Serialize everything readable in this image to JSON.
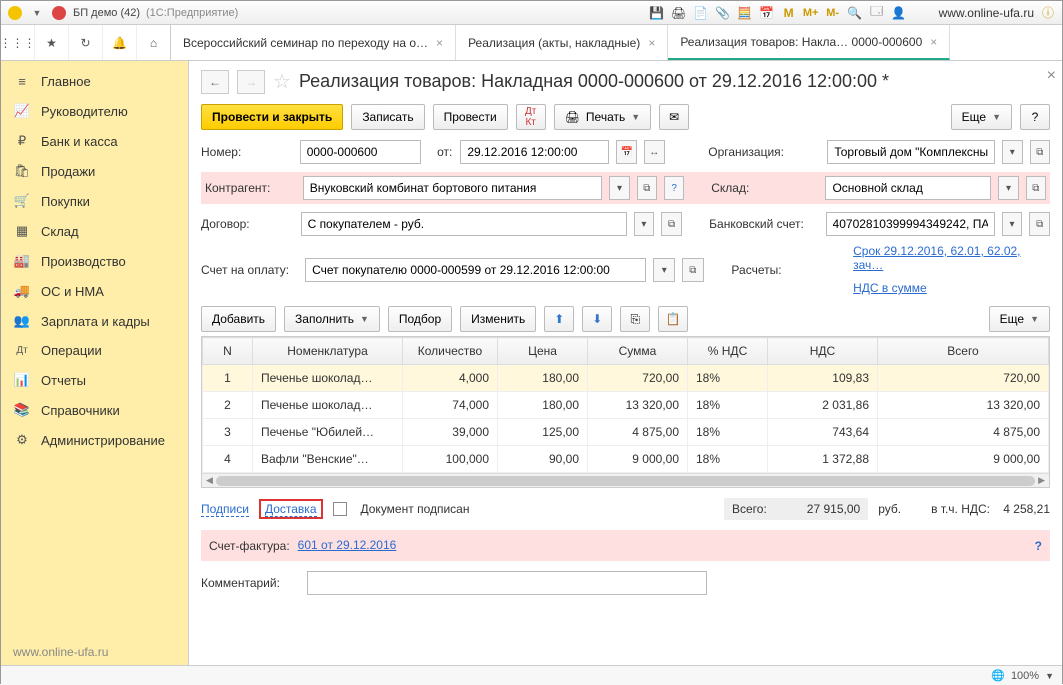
{
  "titlebar": {
    "app_name": "БП демо (42)",
    "platform": "(1С:Предприятие)",
    "url": "www.online-ufa.ru"
  },
  "tabs": [
    {
      "label": "Всероссийский семинар по переходу на о…",
      "active": false
    },
    {
      "label": "Реализация (акты, накладные)",
      "active": false
    },
    {
      "label": "Реализация товаров: Накла…   0000-000600",
      "active": true
    }
  ],
  "sidebar": {
    "items": [
      {
        "icon": "≡",
        "label": "Главное"
      },
      {
        "icon": "📈",
        "label": "Руководителю"
      },
      {
        "icon": "₽",
        "label": "Банк и касса"
      },
      {
        "icon": "🛍",
        "label": "Продажи"
      },
      {
        "icon": "🛒",
        "label": "Покупки"
      },
      {
        "icon": "▦",
        "label": "Склад"
      },
      {
        "icon": "🏭",
        "label": "Производство"
      },
      {
        "icon": "🚚",
        "label": "ОС и НМА"
      },
      {
        "icon": "👥",
        "label": "Зарплата и кадры"
      },
      {
        "icon": "Дт",
        "label": "Операции"
      },
      {
        "icon": "📊",
        "label": "Отчеты"
      },
      {
        "icon": "📚",
        "label": "Справочники"
      },
      {
        "icon": "⚙",
        "label": "Администрирование"
      }
    ],
    "footer": "www.online-ufa.ru"
  },
  "page": {
    "title": "Реализация товаров: Накладная 0000-000600 от 29.12.2016 12:00:00 *"
  },
  "toolbar": {
    "post_close": "Провести и закрыть",
    "save": "Записать",
    "post": "Провести",
    "print": "Печать",
    "more": "Еще"
  },
  "form": {
    "number_label": "Номер:",
    "number": "0000-000600",
    "from_label": "от:",
    "date": "29.12.2016 12:00:00",
    "org_label": "Организация:",
    "org": "Торговый дом \"Комплексный",
    "contragent_label": "Контрагент:",
    "contragent": "Внуковский комбинат бортового питания",
    "warehouse_label": "Склад:",
    "warehouse": "Основной склад",
    "contract_label": "Договор:",
    "contract": "С покупателем - руб.",
    "bank_label": "Банковский счет:",
    "bank": "40702810399994349242, ПА",
    "invoice_label": "Счет на оплату:",
    "invoice": "Счет покупателю 0000-000599 от 29.12.2016 12:00:00",
    "calc_label": "Расчеты:",
    "calc_link": "Срок 29.12.2016, 62.01, 62.02, зач…",
    "vat_link": "НДС в сумме"
  },
  "grid_toolbar": {
    "add": "Добавить",
    "fill": "Заполнить",
    "select": "Подбор",
    "change": "Изменить",
    "more": "Еще"
  },
  "grid": {
    "headers": [
      "N",
      "Номенклатура",
      "Количество",
      "Цена",
      "Сумма",
      "% НДС",
      "НДС",
      "Всего"
    ],
    "rows": [
      {
        "n": "1",
        "nom": "Печенье шоколад…",
        "qty": "4,000",
        "price": "180,00",
        "sum": "720,00",
        "vat_pct": "18%",
        "vat": "109,83",
        "total": "720,00"
      },
      {
        "n": "2",
        "nom": "Печенье шоколад…",
        "qty": "74,000",
        "price": "180,00",
        "sum": "13 320,00",
        "vat_pct": "18%",
        "vat": "2 031,86",
        "total": "13 320,00"
      },
      {
        "n": "3",
        "nom": "Печенье \"Юбилей…",
        "qty": "39,000",
        "price": "125,00",
        "sum": "4 875,00",
        "vat_pct": "18%",
        "vat": "743,64",
        "total": "4 875,00"
      },
      {
        "n": "4",
        "nom": "Вафли \"Венские\"…",
        "qty": "100,000",
        "price": "90,00",
        "sum": "9 000,00",
        "vat_pct": "18%",
        "vat": "1 372,88",
        "total": "9 000,00"
      }
    ]
  },
  "footer": {
    "signatures": "Подписи",
    "delivery": "Доставка",
    "signed": "Документ подписан",
    "total_label": "Всего:",
    "total": "27 915,00",
    "rub": "руб.",
    "vat_label": "в т.ч. НДС:",
    "vat": "4 258,21",
    "facture_label": "Счет-фактура:",
    "facture_link": "601 от 29.12.2016",
    "comment_label": "Комментарий:"
  },
  "status": {
    "zoom": "100%"
  }
}
